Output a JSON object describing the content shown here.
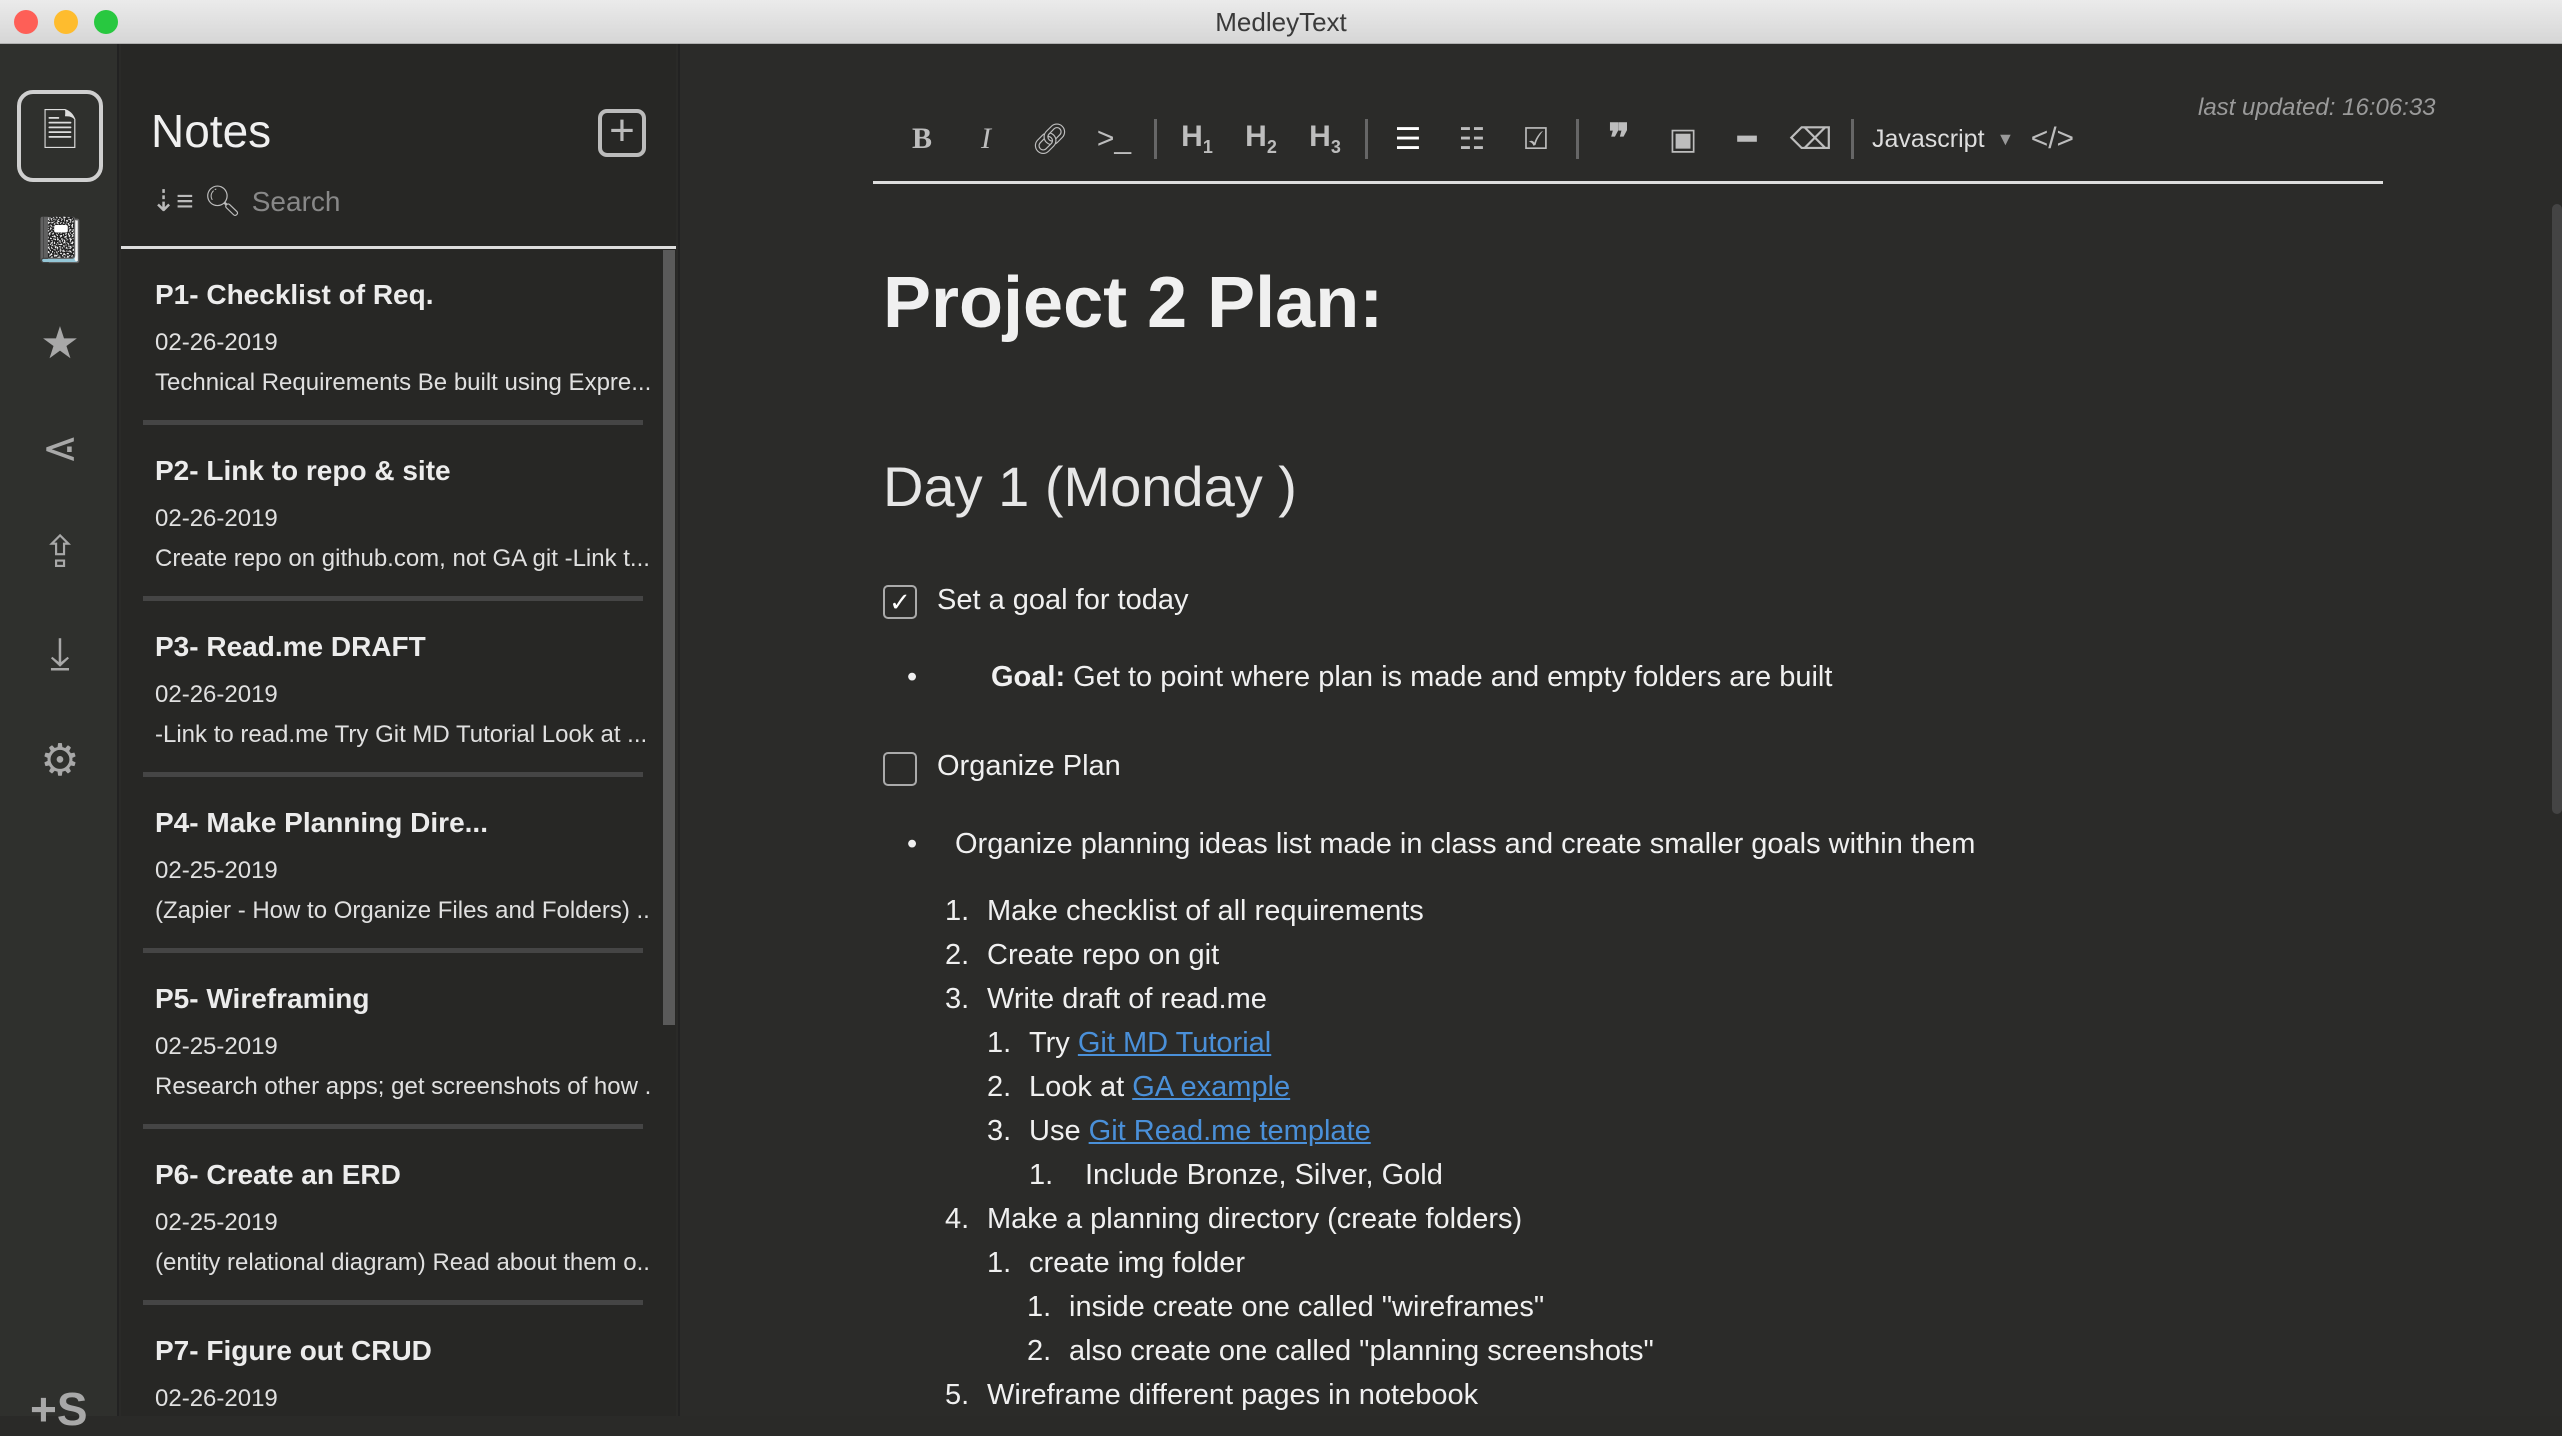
{
  "window": {
    "title": "MedleyText"
  },
  "rail": {
    "items": [
      {
        "icon": "note-icon"
      },
      {
        "icon": "notebook-icon"
      },
      {
        "icon": "star-icon"
      },
      {
        "icon": "share-icon"
      },
      {
        "icon": "upload-icon"
      },
      {
        "icon": "download-icon"
      },
      {
        "icon": "gear-icon"
      }
    ],
    "logo": "+S"
  },
  "notes": {
    "title": "Notes",
    "search_placeholder": "Search",
    "items": [
      {
        "title": "P1- Checklist of Req.",
        "date": "02-26-2019",
        "preview": "Technical Requirements Be built using Expre..."
      },
      {
        "title": "P2- Link to repo & site",
        "date": "02-26-2019",
        "preview": "Create repo on github.com, not GA git -Link t..."
      },
      {
        "title": "P3- Read.me DRAFT",
        "date": "02-26-2019",
        "preview": "-Link to read.me Try Git MD Tutorial Look at ..."
      },
      {
        "title": "P4- Make Planning Dire...",
        "date": "02-25-2019",
        "preview": "(Zapier - How to Organize Files and Folders) ..."
      },
      {
        "title": "P5- Wireframing",
        "date": "02-25-2019",
        "preview": "Research other apps; get screenshots of how ..."
      },
      {
        "title": "P6- Create an ERD",
        "date": "02-25-2019",
        "preview": "(entity relational diagram) Read about them o..."
      },
      {
        "title": "P7- Figure out CRUD",
        "date": "02-26-2019",
        "preview": ""
      }
    ]
  },
  "editor": {
    "last_updated": "last updated: 16:06:33",
    "language": "Javascript",
    "title": "Project 2 Plan:",
    "day": "Day 1 (Monday )",
    "task1": {
      "label": "Set a goal for today",
      "checked": true
    },
    "goal_label": "Goal:",
    "goal_text": " Get to point where plan is made and empty folders are built",
    "task2": {
      "label": "Organize Plan",
      "checked": false
    },
    "bullet2": "Organize planning ideas list made in class and create smaller goals within them",
    "list": {
      "i1": "Make checklist of all requirements",
      "i2": "Create repo on git",
      "i3": "Write draft of read.me",
      "i3a_pre": "Try ",
      "i3a_link": "Git MD Tutorial",
      "i3b_pre": "Look at ",
      "i3b_link": "GA example",
      "i3c_pre": "Use ",
      "i3c_link": "Git Read.me template",
      "i3c1": "Include Bronze, Silver, Gold",
      "i4": "Make a planning directory (create folders)",
      "i4a": "create img folder",
      "i4a1": "inside create one called \"wireframes\"",
      "i4a2": "also create one called \"planning screenshots\"",
      "i5": "Wireframe different pages in notebook"
    },
    "nums": [
      "1.",
      "2.",
      "3.",
      "4.",
      "5."
    ]
  }
}
